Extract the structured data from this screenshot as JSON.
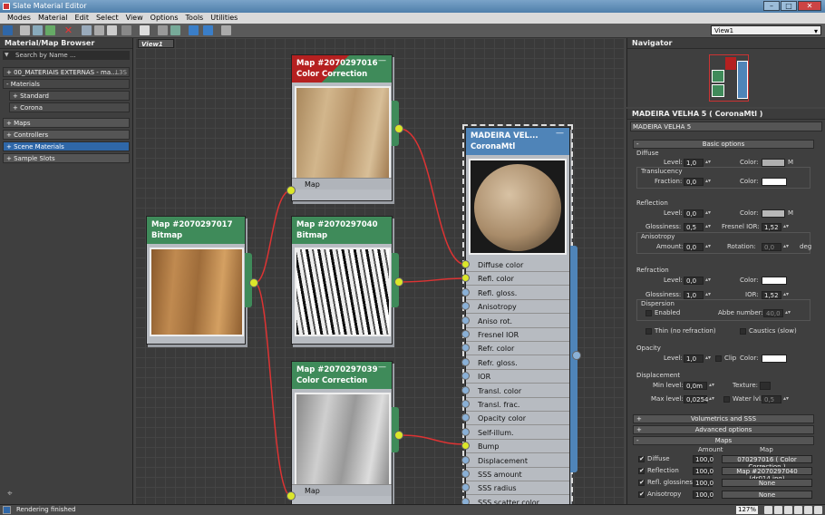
{
  "window": {
    "title": "Slate Material Editor"
  },
  "menu": [
    "Modes",
    "Material",
    "Edit",
    "Select",
    "View",
    "Options",
    "Tools",
    "Utilities"
  ],
  "toolbar": {
    "view_selector": "View1"
  },
  "browser": {
    "title": "Material/Map Browser",
    "search_placeholder": "Search by Name ...",
    "rows": [
      {
        "label": "+ 00_MATERIAIS EXTERNAS - ma...",
        "badge": "L3S"
      },
      {
        "label": "- Materials",
        "badge": ""
      },
      {
        "label": "+ Standard",
        "badge": ""
      },
      {
        "label": "+ Corona",
        "badge": ""
      },
      {
        "label": "+ Maps",
        "badge": ""
      },
      {
        "label": "+ Controllers",
        "badge": ""
      },
      {
        "label": "+ Scene Materials",
        "badge": ""
      },
      {
        "label": "+ Sample Slots",
        "badge": ""
      }
    ]
  },
  "view": {
    "tab": "View1"
  },
  "nodes": {
    "cc1": {
      "title": "Map #2070297016",
      "type": "Color Correction",
      "slot": "Map"
    },
    "bitmap1": {
      "title": "Map #2070297017",
      "type": "Bitmap"
    },
    "bitmap2": {
      "title": "Map #2070297040",
      "type": "Bitmap"
    },
    "cc2": {
      "title": "Map #2070297039",
      "type": "Color Correction",
      "slot": "Map"
    },
    "material": {
      "title": "MADEIRA  VEL...",
      "type": "CoronaMtl",
      "slots": [
        "Diffuse color",
        "Refl. color",
        "Refl. gloss.",
        "Anisotropy",
        "Aniso rot.",
        "Fresnel IOR",
        "Refr. color",
        "Refr. gloss.",
        "IOR",
        "Transl. color",
        "Transl. frac.",
        "Opacity color",
        "Self-illum.",
        "Bump",
        "Displacement",
        "SSS amount",
        "SSS radius",
        "SSS scatter color"
      ]
    }
  },
  "navigator": {
    "title": "Navigator"
  },
  "properties": {
    "header": "MADEIRA VELHA 5  ( CoronaMtl )",
    "name": "MADEIRA VELHA 5",
    "basic": {
      "title": "Basic options",
      "diffuse": {
        "section": "Diffuse",
        "level_label": "Level:",
        "level": "1,0",
        "color_label": "Color:",
        "map_btn": "M",
        "transl": "Translucency",
        "fraction_label": "Fraction:",
        "fraction": "0,0",
        "color2_label": "Color:"
      },
      "reflection": {
        "section": "Reflection",
        "level_label": "Level:",
        "level": "0,0",
        "color_label": "Color:",
        "map_btn": "M",
        "gloss_label": "Glossiness:",
        "gloss": "0,5",
        "fresnel_label": "Fresnel IOR:",
        "fresnel": "1,52",
        "aniso": "Anisotropy",
        "amount_label": "Amount:",
        "amount": "0,0",
        "rotation_label": "Rotation:",
        "rotation": "0,0",
        "deg": "deg"
      },
      "refraction": {
        "section": "Refraction",
        "level_label": "Level:",
        "level": "0,0",
        "color_label": "Color:",
        "gloss_label": "Glossiness:",
        "gloss": "1,0",
        "ior_label": "IOR:",
        "ior": "1,52",
        "dispersion": "Dispersion",
        "enabled": "Enabled",
        "abbe_label": "Abbe number:",
        "abbe": "40,0",
        "thin": "Thin (no refraction)",
        "caustics": "Caustics (slow)"
      },
      "opacity": {
        "section": "Opacity",
        "level_label": "Level:",
        "level": "1,0",
        "clip": "Clip",
        "color_label": "Color:"
      },
      "displacement": {
        "section": "Displacement",
        "min_label": "Min level:",
        "min": "0,0m",
        "texture_label": "Texture:",
        "max_label": "Max level:",
        "max": "0,0254",
        "water_label": "Water lvl.",
        "water": "0,5"
      }
    },
    "rollouts": [
      {
        "sign": "+",
        "label": "Volumetrics and SSS"
      },
      {
        "sign": "+",
        "label": "Advanced options"
      },
      {
        "sign": "-",
        "label": "Maps"
      }
    ],
    "maps": {
      "col_amount": "Amount",
      "col_map": "Map",
      "rows": [
        {
          "name": "Diffuse",
          "amount": "100,0",
          "map": "070297016  ( Color Correction )"
        },
        {
          "name": "Reflection",
          "amount": "100,0",
          "map": "Map #2070297040 (dr014.jpg)"
        },
        {
          "name": "Refl. glossiness",
          "amount": "100,0",
          "map": "None"
        },
        {
          "name": "Anisotropy",
          "amount": "100,0",
          "map": "None"
        }
      ]
    }
  },
  "status": {
    "text": "Rendering finished",
    "zoom": "127%"
  }
}
